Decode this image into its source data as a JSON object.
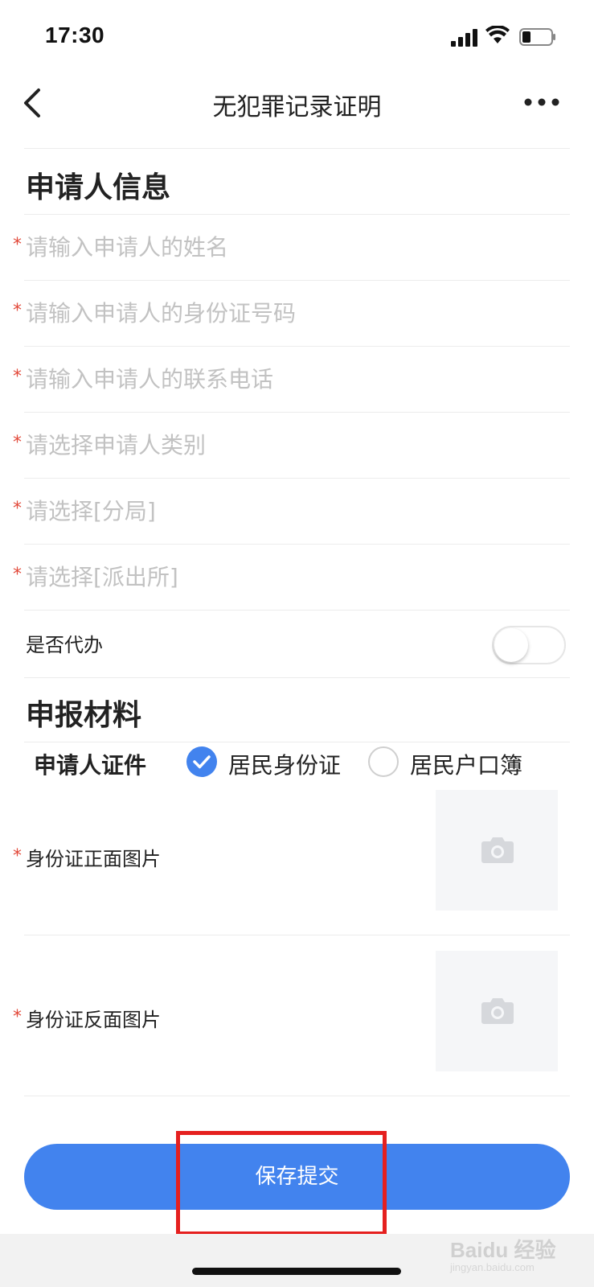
{
  "status_bar": {
    "time": "17:30"
  },
  "nav": {
    "title": "无犯罪记录证明"
  },
  "applicant_section": {
    "title": "申请人信息",
    "fields": [
      {
        "placeholder": "请输入申请人的姓名",
        "value": ""
      },
      {
        "placeholder": "请输入申请人的身份证号码",
        "value": ""
      },
      {
        "placeholder": "请输入申请人的联系电话",
        "value": ""
      },
      {
        "placeholder": "请选择申请人类别",
        "value": ""
      },
      {
        "placeholder": "请选择[分局]",
        "value": ""
      },
      {
        "placeholder": "请选择[派出所]",
        "value": ""
      }
    ],
    "proxy_label": "是否代办",
    "proxy_enabled": false
  },
  "materials_section": {
    "title": "申报材料",
    "cert_label": "申请人证件",
    "cert_options": [
      {
        "label": "居民身份证",
        "selected": true
      },
      {
        "label": "居民户口簿",
        "selected": false
      }
    ],
    "uploads": [
      {
        "label": "身份证正面图片"
      },
      {
        "label": "身份证反面图片"
      }
    ]
  },
  "submit_label": "保存提交",
  "required_mark": "*",
  "watermark": {
    "text": "Baidu 经验",
    "sub": "jingyan.baidu.com"
  },
  "colors": {
    "accent": "#4283ee",
    "required": "#e24a3b",
    "highlight": "#e5201f"
  }
}
